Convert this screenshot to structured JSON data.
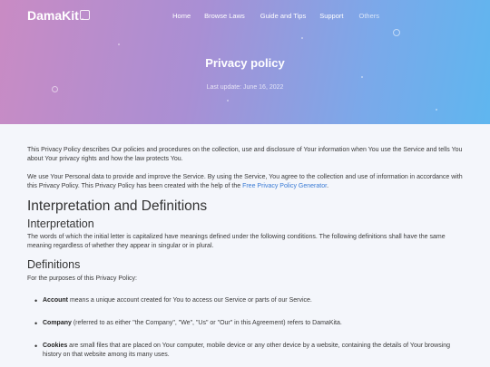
{
  "brand": {
    "name": "DamaKit"
  },
  "nav": {
    "items": [
      "Home",
      "Browse Laws",
      "Guide and Tips",
      "Support",
      "Others"
    ]
  },
  "hero": {
    "title": "Privacy policy",
    "subtitle": "Last update: June 16, 2022"
  },
  "content": {
    "intro1": "This Privacy Policy describes Our policies and procedures on the collection, use and disclosure of Your information when You use the Service and tells You about Your privacy rights and how the law protects You.",
    "intro2_before": "We use Your Personal data to provide and improve the Service. By using the Service, You agree to the collection and use of information in accordance with this Privacy Policy. This Privacy Policy has been created with the help of the ",
    "intro2_link": "Free Privacy Policy Generator",
    "intro2_after": ".",
    "h_interp_def": "Interpretation and Definitions",
    "h_interp": "Interpretation",
    "interp_text": "The words of which the initial letter is capitalized have meanings defined under the following conditions. The following definitions shall have the same meaning regardless of whether they appear in singular or in plural.",
    "h_defs": "Definitions",
    "defs_intro": "For the purposes of this Privacy Policy:",
    "definitions": [
      {
        "term": "Account",
        "text": " means a unique account created for You to access our Service or parts of our Service."
      },
      {
        "term": "Company",
        "text": " (referred to as either \"the Company\", \"We\", \"Us\" or \"Our\" in this Agreement) refers to DamaKita."
      },
      {
        "term": "Cookies",
        "text": " are small files that are placed on Your computer, mobile device or any other device by a website, containing the details of Your browsing history on that website among its many uses."
      }
    ]
  }
}
